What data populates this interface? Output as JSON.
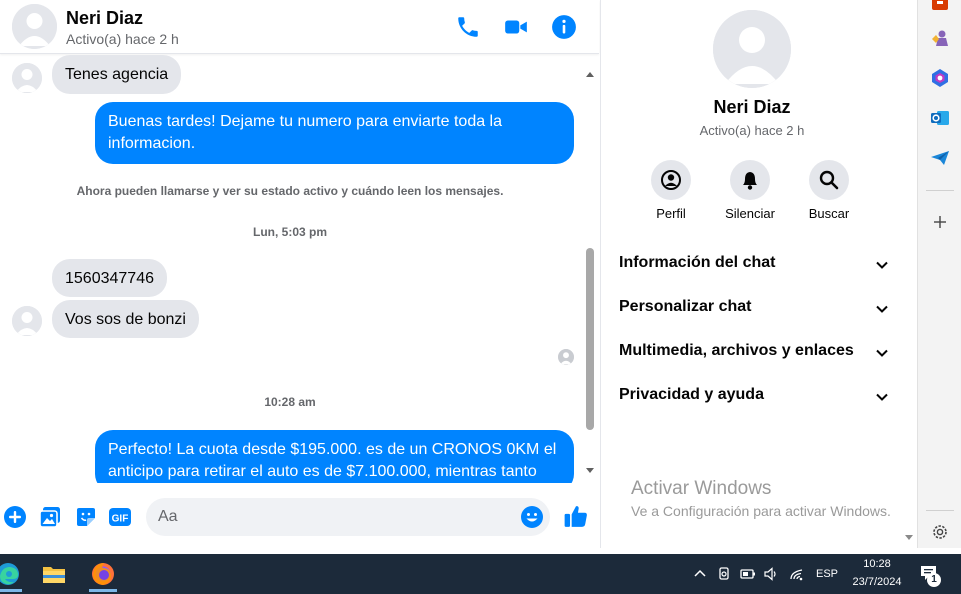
{
  "chat": {
    "contact_name": "Neri Diaz",
    "status": "Activo(a) hace 2 h"
  },
  "messages": {
    "m1": "Tenes agencia",
    "m2": "Buenas tardes! Dejame tu numero para enviarte toda la informacion.",
    "system_notice": "Ahora pueden llamarse y ver su estado activo y cuándo leen los mensajes.",
    "timestamp1": "Lun, 5:03 pm",
    "m3": "1560347746",
    "m4": "Vos sos de bonzi",
    "timestamp2": "10:28 am",
    "m5": "Perfecto! La cuota desde $195.000. es de un CRONOS 0KM el anticipo para retirar el auto es de $7.100.000, mientras tanto"
  },
  "composer": {
    "placeholder": "Aa"
  },
  "info": {
    "name": "Neri Diaz",
    "status": "Activo(a) hace 2 h",
    "actions": [
      "Perfil",
      "Silenciar",
      "Buscar"
    ],
    "sections": [
      "Información del chat",
      "Personalizar chat",
      "Multimedia, archivos y enlaces",
      "Privacidad y ayuda"
    ]
  },
  "watermark": {
    "title": "Activar Windows",
    "subtitle": "Ve a Configuración para activar Windows."
  },
  "taskbar": {
    "language": "ESP",
    "time": "10:28",
    "date": "23/7/2024",
    "notification_count": "1"
  },
  "colors": {
    "accent": "#0084ff",
    "bubble_in": "#e4e6eb",
    "taskbar": "#1c2a3a"
  }
}
